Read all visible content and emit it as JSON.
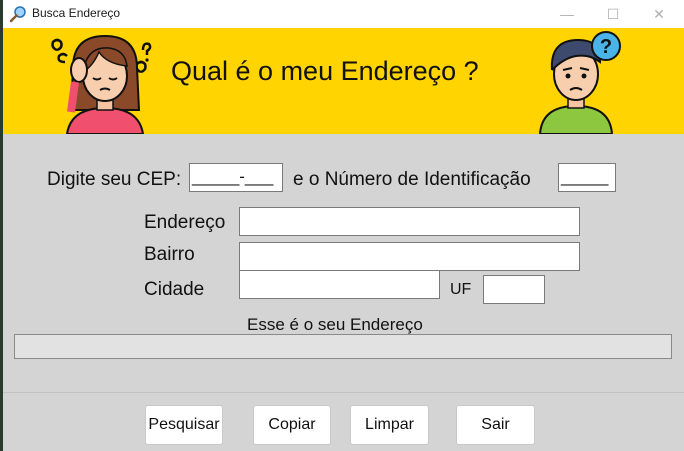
{
  "window": {
    "title": "Busca Endereço",
    "controls": {
      "minimize": "—",
      "maximize": "☐",
      "close": "✕"
    }
  },
  "banner": {
    "title": "Qual é o meu Endereço ?",
    "background": "#ffd400"
  },
  "form": {
    "cep_label": "Digite seu CEP:",
    "cep_value": "_____-___",
    "numero_label": "e o Número de Identificação",
    "numero_value": "_____",
    "endereco_label": "Endereço",
    "endereco_value": "",
    "bairro_label": "Bairro",
    "bairro_value": "",
    "cidade_label": "Cidade",
    "cidade_value": "",
    "uf_label": "UF",
    "uf_value": "",
    "result_label": "Esse é o seu Endereço",
    "result_value": ""
  },
  "buttons": {
    "pesquisar": "Pesquisar",
    "copiar": "Copiar",
    "limpar": "Limpar",
    "sair": "Sair"
  }
}
